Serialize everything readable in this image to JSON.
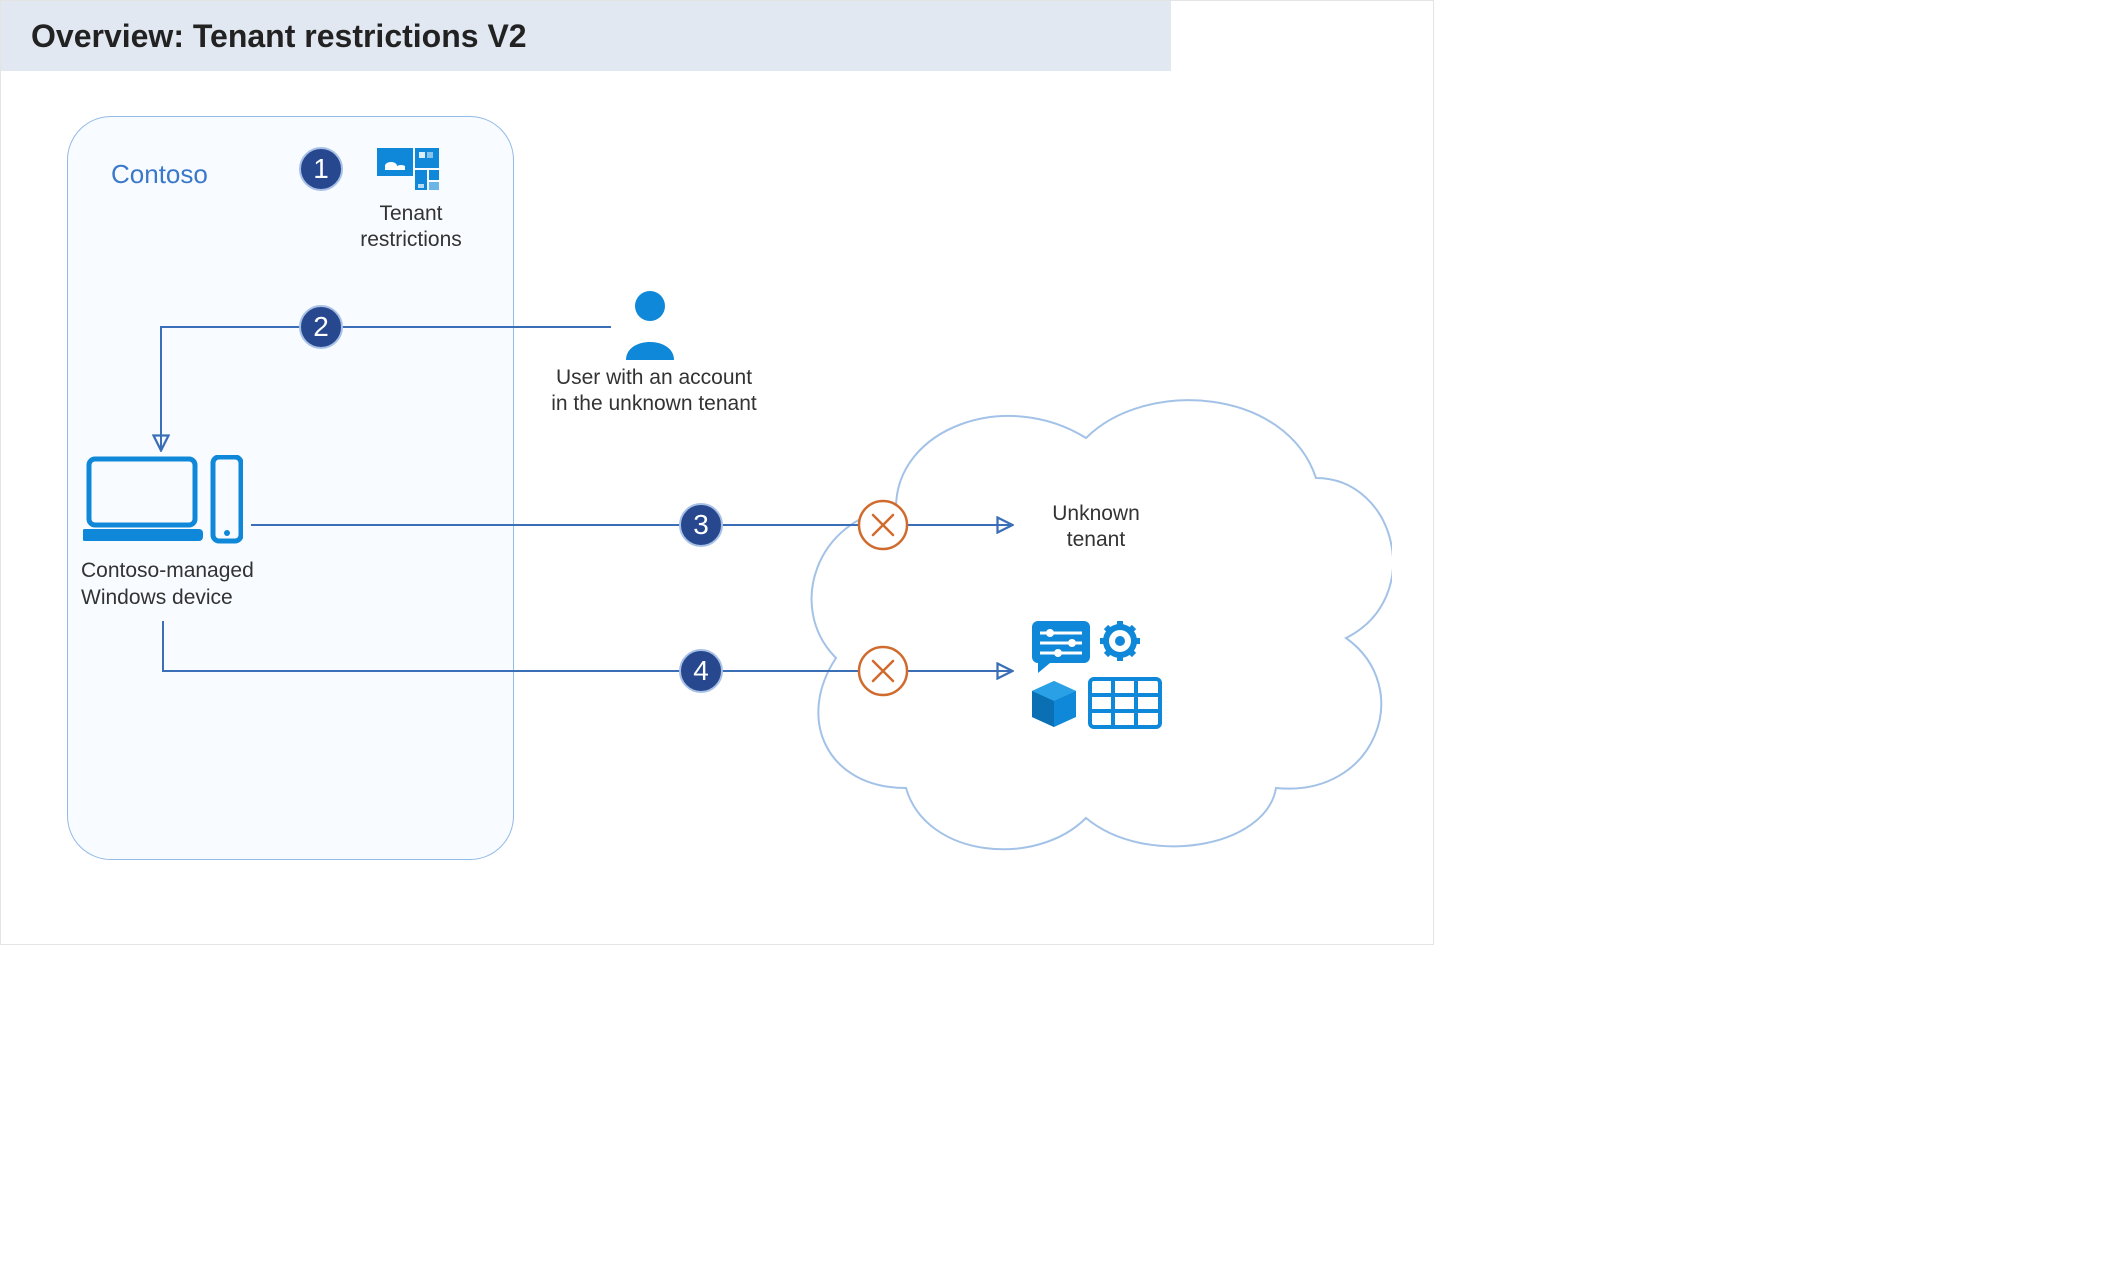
{
  "title": "Overview: Tenant restrictions V2",
  "contoso": {
    "label": "Contoso"
  },
  "badges": {
    "b1": "1",
    "b2": "2",
    "b3": "3",
    "b4": "4"
  },
  "labels": {
    "tenant_restrictions": "Tenant restrictions",
    "user": "User with an account in the unknown tenant",
    "device": "Contoso-managed Windows device",
    "unknown_tenant": "Unknown tenant"
  },
  "colors": {
    "azure_blue": "#0f88d9",
    "badge_fill": "#27488f",
    "block_orange": "#d06b2e",
    "line_blue": "#3a6fb7"
  }
}
